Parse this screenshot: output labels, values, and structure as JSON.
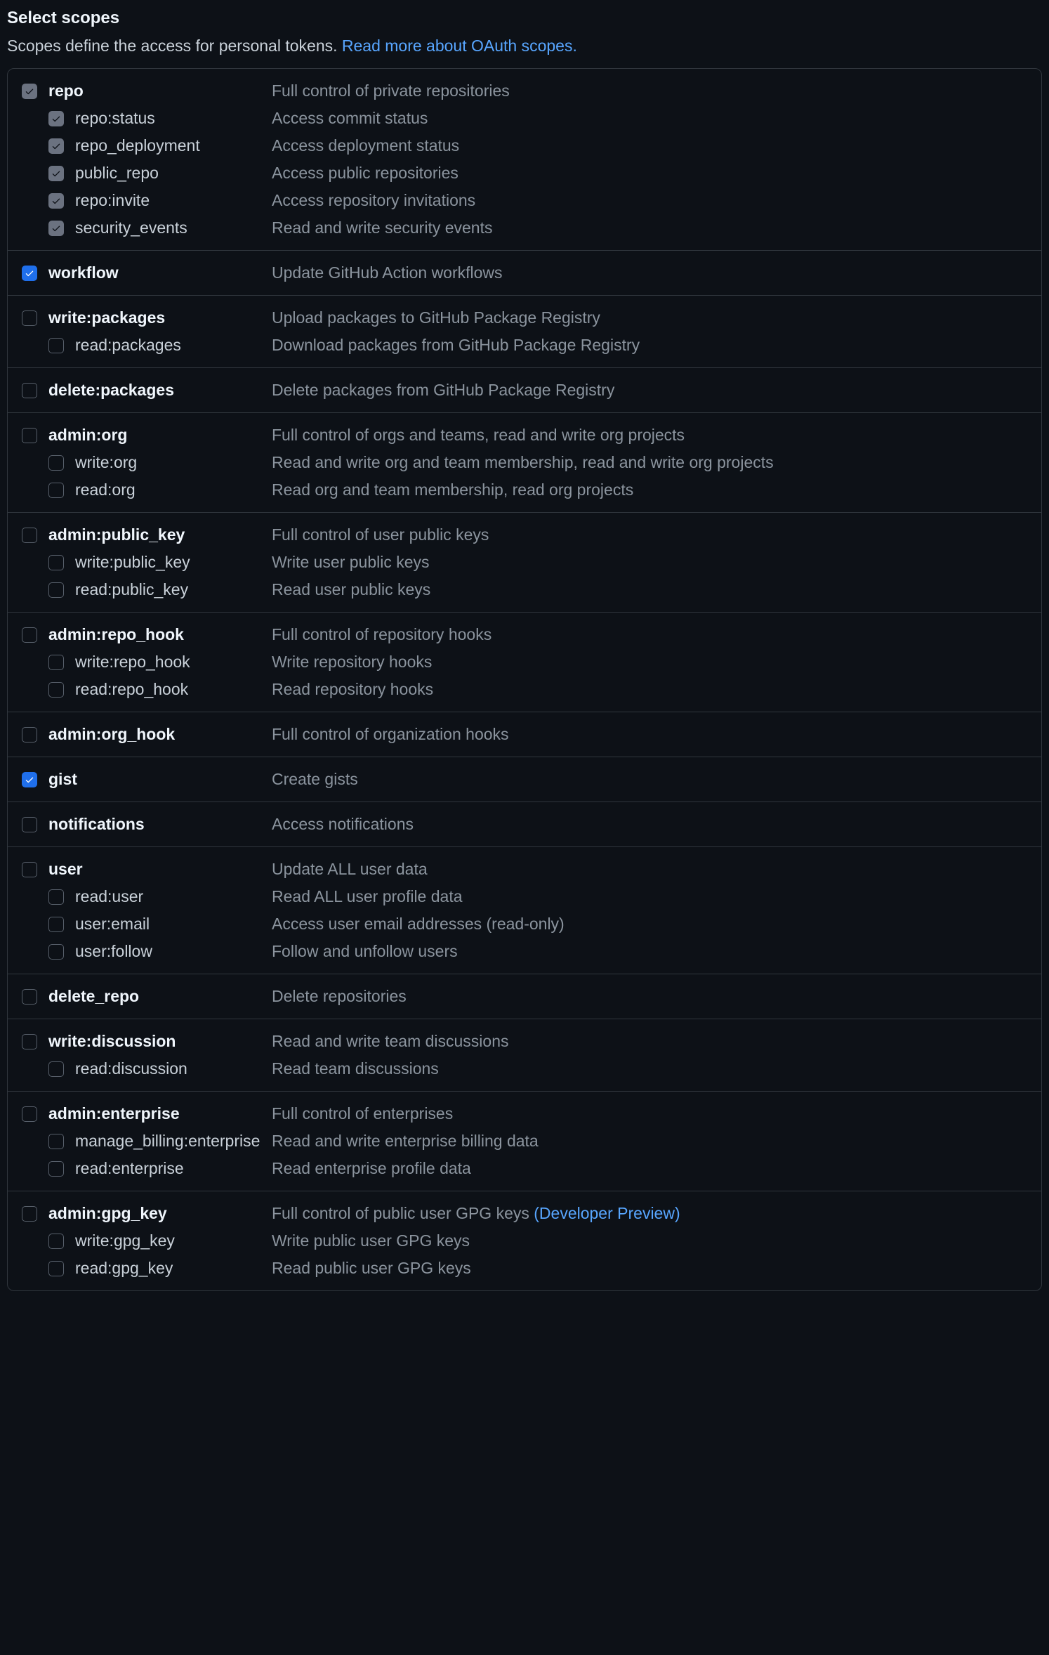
{
  "header": {
    "title": "Select scopes",
    "subtext": "Scopes define the access for personal tokens. ",
    "link_text": "Read more about OAuth scopes."
  },
  "scopes": [
    {
      "name": "repo",
      "desc": "Full control of private repositories",
      "checked": "grey",
      "children": [
        {
          "name": "repo:status",
          "desc": "Access commit status",
          "checked": "grey"
        },
        {
          "name": "repo_deployment",
          "desc": "Access deployment status",
          "checked": "grey"
        },
        {
          "name": "public_repo",
          "desc": "Access public repositories",
          "checked": "grey"
        },
        {
          "name": "repo:invite",
          "desc": "Access repository invitations",
          "checked": "grey"
        },
        {
          "name": "security_events",
          "desc": "Read and write security events",
          "checked": "grey"
        }
      ]
    },
    {
      "name": "workflow",
      "desc": "Update GitHub Action workflows",
      "checked": "blue",
      "children": []
    },
    {
      "name": "write:packages",
      "desc": "Upload packages to GitHub Package Registry",
      "checked": "none",
      "children": [
        {
          "name": "read:packages",
          "desc": "Download packages from GitHub Package Registry",
          "checked": "none"
        }
      ]
    },
    {
      "name": "delete:packages",
      "desc": "Delete packages from GitHub Package Registry",
      "checked": "none",
      "children": []
    },
    {
      "name": "admin:org",
      "desc": "Full control of orgs and teams, read and write org projects",
      "checked": "none",
      "children": [
        {
          "name": "write:org",
          "desc": "Read and write org and team membership, read and write org projects",
          "checked": "none"
        },
        {
          "name": "read:org",
          "desc": "Read org and team membership, read org projects",
          "checked": "none"
        }
      ]
    },
    {
      "name": "admin:public_key",
      "desc": "Full control of user public keys",
      "checked": "none",
      "children": [
        {
          "name": "write:public_key",
          "desc": "Write user public keys",
          "checked": "none"
        },
        {
          "name": "read:public_key",
          "desc": "Read user public keys",
          "checked": "none"
        }
      ]
    },
    {
      "name": "admin:repo_hook",
      "desc": "Full control of repository hooks",
      "checked": "none",
      "children": [
        {
          "name": "write:repo_hook",
          "desc": "Write repository hooks",
          "checked": "none"
        },
        {
          "name": "read:repo_hook",
          "desc": "Read repository hooks",
          "checked": "none"
        }
      ]
    },
    {
      "name": "admin:org_hook",
      "desc": "Full control of organization hooks",
      "checked": "none",
      "children": []
    },
    {
      "name": "gist",
      "desc": "Create gists",
      "checked": "blue",
      "children": []
    },
    {
      "name": "notifications",
      "desc": "Access notifications",
      "checked": "none",
      "children": []
    },
    {
      "name": "user",
      "desc": "Update ALL user data",
      "checked": "none",
      "children": [
        {
          "name": "read:user",
          "desc": "Read ALL user profile data",
          "checked": "none"
        },
        {
          "name": "user:email",
          "desc": "Access user email addresses (read-only)",
          "checked": "none"
        },
        {
          "name": "user:follow",
          "desc": "Follow and unfollow users",
          "checked": "none"
        }
      ]
    },
    {
      "name": "delete_repo",
      "desc": "Delete repositories",
      "checked": "none",
      "children": []
    },
    {
      "name": "write:discussion",
      "desc": "Read and write team discussions",
      "checked": "none",
      "children": [
        {
          "name": "read:discussion",
          "desc": "Read team discussions",
          "checked": "none"
        }
      ]
    },
    {
      "name": "admin:enterprise",
      "desc": "Full control of enterprises",
      "checked": "none",
      "children": [
        {
          "name": "manage_billing:enterprise",
          "desc": "Read and write enterprise billing data",
          "checked": "none"
        },
        {
          "name": "read:enterprise",
          "desc": "Read enterprise profile data",
          "checked": "none"
        }
      ]
    },
    {
      "name": "admin:gpg_key",
      "desc": "Full control of public user GPG keys ",
      "desc_link": "(Developer Preview)",
      "checked": "none",
      "children": [
        {
          "name": "write:gpg_key",
          "desc": "Write public user GPG keys",
          "checked": "none"
        },
        {
          "name": "read:gpg_key",
          "desc": "Read public user GPG keys",
          "checked": "none"
        }
      ]
    }
  ]
}
